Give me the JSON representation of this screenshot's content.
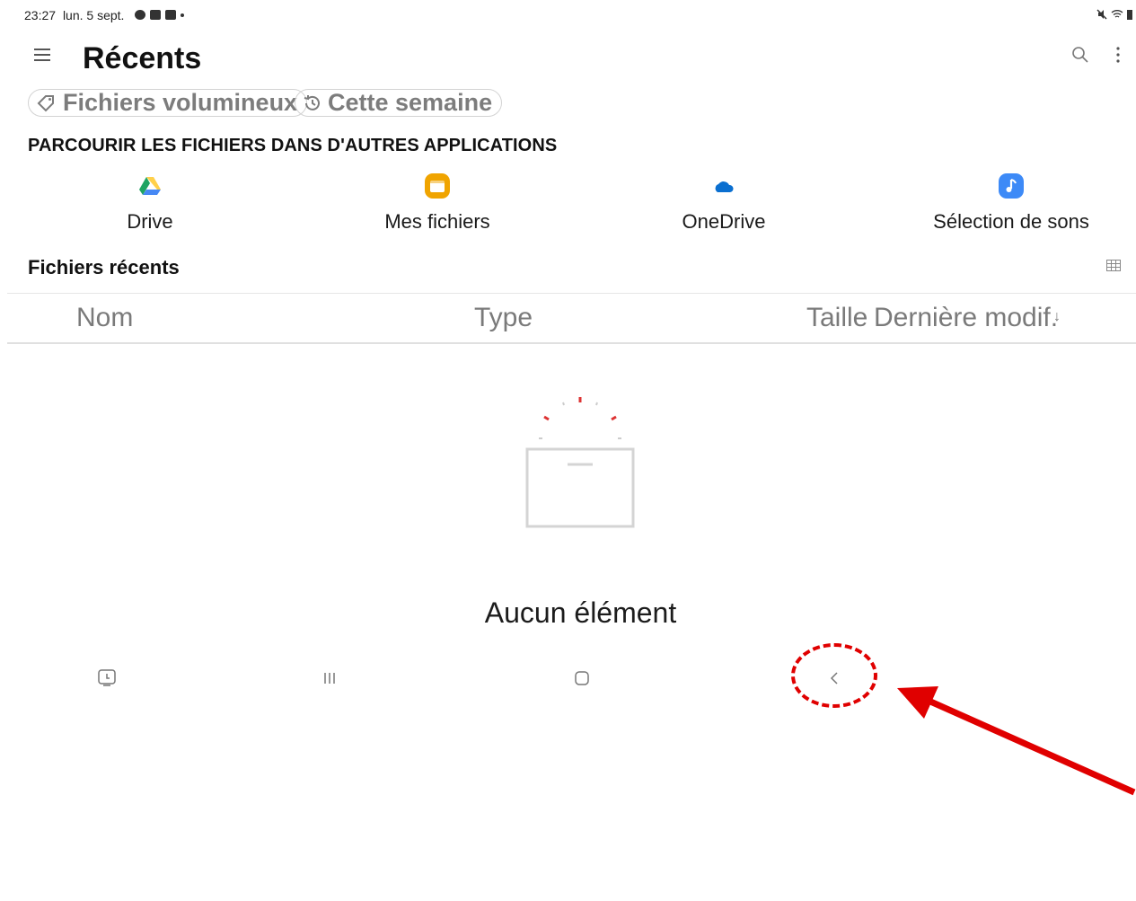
{
  "status_bar": {
    "time": "23:27",
    "date": "lun. 5 sept.",
    "icons": [
      "chat-icon",
      "gallery-icon",
      "photo-icon",
      "notification-dot"
    ],
    "right_icons": [
      "mute-icon",
      "wifi-icon",
      "battery-icon"
    ]
  },
  "header": {
    "title": "Récents",
    "menu_icon": "hamburger-menu-icon",
    "search_icon": "search-icon",
    "more_icon": "more-vertical-icon"
  },
  "filters": [
    {
      "label": "Fichiers volumineux",
      "icon": "tag-icon"
    },
    {
      "label": "Cette semaine",
      "icon": "history-icon"
    }
  ],
  "browse_section": {
    "title": "PARCOURIR LES FICHIERS DANS D'AUTRES APPLICATIONS",
    "apps": [
      {
        "label": "Drive",
        "icon": "google-drive-icon"
      },
      {
        "label": "Mes fichiers",
        "icon": "my-files-icon"
      },
      {
        "label": "OneDrive",
        "icon": "onedrive-icon"
      },
      {
        "label": "Sélection de sons",
        "icon": "sound-picker-icon"
      }
    ]
  },
  "recent_files": {
    "title": "Fichiers récents",
    "view_icon": "grid-view-icon",
    "columns": [
      "Nom",
      "Type",
      "Taille",
      "Dernière modif."
    ],
    "sort_icon": "sort-down-arrow-icon",
    "empty_text": "Aucun élément"
  },
  "nav_bar": {
    "buttons": [
      "screenshot-nav-icon",
      "recents-nav-icon",
      "home-nav-icon",
      "back-nav-icon"
    ]
  },
  "colors": {
    "accent_red": "#e00000",
    "drive_green": "#1fa463",
    "drive_yellow": "#ffd04b",
    "drive_blue": "#4688f4",
    "myfiles_orange": "#f0a400",
    "onedrive_blue": "#0a6fd0",
    "sounds_blue": "#3d8af7"
  }
}
